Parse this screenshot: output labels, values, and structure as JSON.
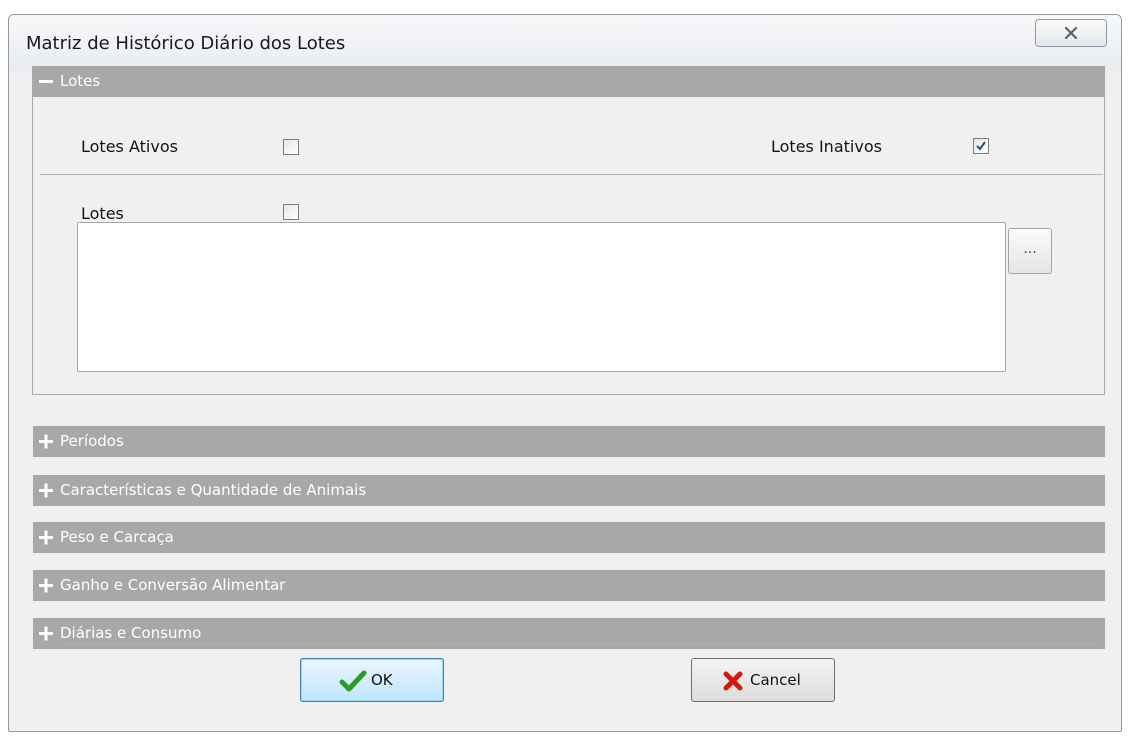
{
  "window": {
    "title": "Matriz de Histórico Diário dos Lotes",
    "close_icon": "close-icon"
  },
  "lotes_group": {
    "header": "Lotes",
    "expanded": true,
    "lotes_ativos": {
      "label": "Lotes Ativos",
      "checked": false
    },
    "lotes_inativos": {
      "label": "Lotes Inativos",
      "checked": true
    },
    "lotes": {
      "label": "Lotes",
      "checked": false,
      "value": ""
    },
    "browse_button": "..."
  },
  "collapsed_groups": [
    {
      "label": "Períodos"
    },
    {
      "label": "Características e Quantidade de Animais"
    },
    {
      "label": "Peso e Carcaça"
    },
    {
      "label": "Ganho e Conversão Alimentar"
    },
    {
      "label": "Diárias e Consumo"
    }
  ],
  "buttons": {
    "ok": "OK",
    "cancel": "Cancel"
  },
  "colors": {
    "group_header": "#a8a8a8",
    "ok_check": "#2e9a1f",
    "cancel_x": "#d01c10"
  }
}
